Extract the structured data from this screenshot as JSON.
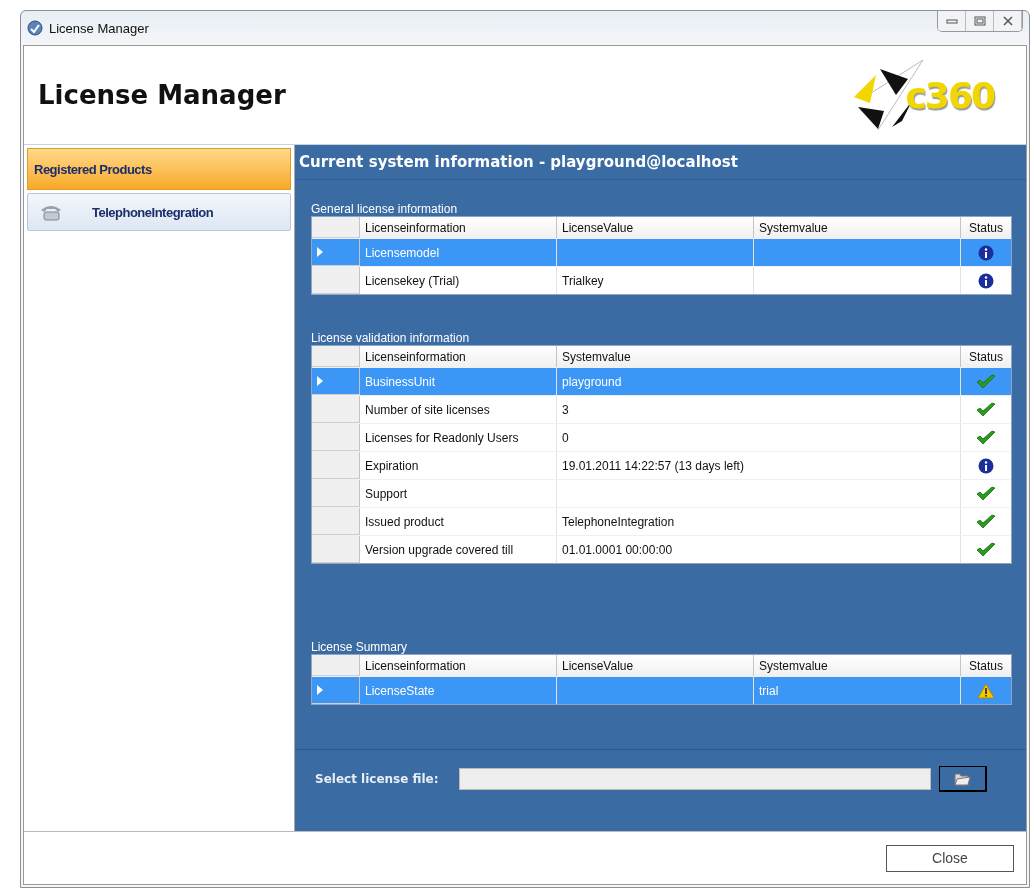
{
  "window": {
    "title": "License Manager"
  },
  "header": {
    "title": "License Manager",
    "logo_text": "c360"
  },
  "sidebar": {
    "group": "Registered Products",
    "items": [
      {
        "label": "TelephoneIntegration",
        "selected": false
      }
    ]
  },
  "panel": {
    "title": "Current system information - playground@localhost"
  },
  "tables": [
    {
      "caption": "General license information",
      "columns": [
        "Licenseinformation",
        "LicenseValue",
        "Systemvalue",
        "Status"
      ],
      "rows": [
        {
          "cells": [
            "Licensemodel",
            "",
            ""
          ],
          "kind": "info",
          "selected": true
        },
        {
          "cells": [
            "Licensekey (Trial)",
            "Trialkey",
            ""
          ],
          "kind": "info",
          "selected": false
        }
      ]
    },
    {
      "caption": "License validation information",
      "columns": [
        "Licenseinformation",
        "Systemvalue",
        "Status"
      ],
      "rows": [
        {
          "cells": [
            "BusinessUnit",
            "playground"
          ],
          "kind": "ok",
          "selected": true
        },
        {
          "cells": [
            "Number of site licenses",
            "3"
          ],
          "kind": "ok",
          "selected": false
        },
        {
          "cells": [
            "Licenses for Readonly Users",
            "0"
          ],
          "kind": "ok",
          "selected": false
        },
        {
          "cells": [
            "Expiration",
            "19.01.2011 14:22:57 (13 days left)"
          ],
          "kind": "info",
          "selected": false
        },
        {
          "cells": [
            "Support",
            ""
          ],
          "kind": "ok",
          "selected": false
        },
        {
          "cells": [
            "Issued product",
            "TelephoneIntegration"
          ],
          "kind": "ok",
          "selected": false
        },
        {
          "cells": [
            "Version upgrade covered till",
            "01.01.0001 00:00:00"
          ],
          "kind": "ok",
          "selected": false
        }
      ]
    },
    {
      "caption": "License Summary",
      "columns": [
        "Licenseinformation",
        "LicenseValue",
        "Systemvalue",
        "Status"
      ],
      "rows": [
        {
          "cells": [
            "LicenseState",
            "",
            "trial"
          ],
          "kind": "warning",
          "selected": true
        }
      ]
    }
  ],
  "file_picker": {
    "label": "Select license file:"
  },
  "buttons": [
    "Close"
  ]
}
